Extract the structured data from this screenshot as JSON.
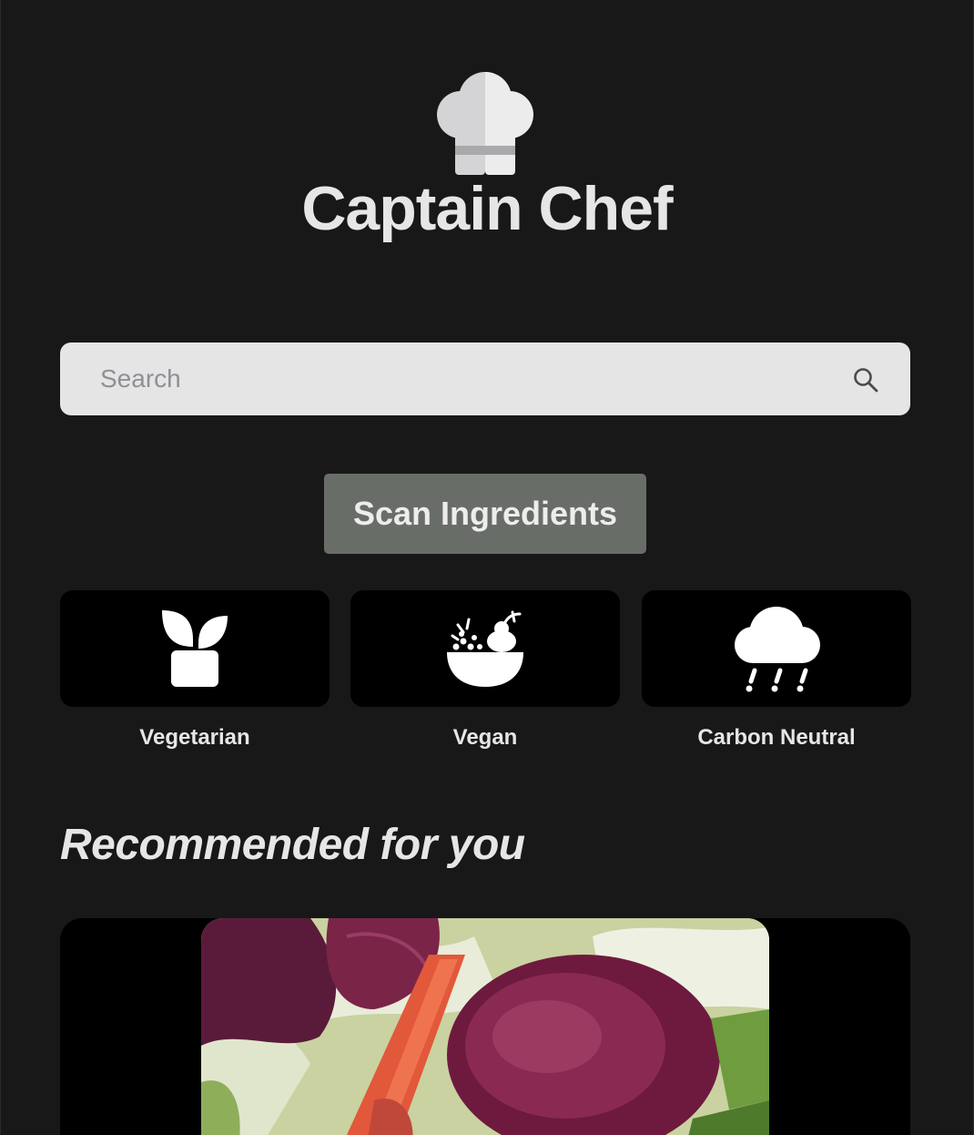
{
  "app": {
    "title": "Captain Chef",
    "logo_icon": "chef-hat-icon"
  },
  "search": {
    "placeholder": "Search",
    "value": "",
    "icon": "search-icon"
  },
  "scan_button": {
    "label": "Scan Ingredients"
  },
  "categories": [
    {
      "label": "Vegetarian",
      "icon": "plant-pot-icon"
    },
    {
      "label": "Vegan",
      "icon": "salad-bowl-icon"
    },
    {
      "label": "Carbon Neutral",
      "icon": "cloud-rain-icon"
    }
  ],
  "recommended": {
    "title": "Recommended for you",
    "items": [
      {
        "image": "beet-salad-photo"
      }
    ]
  },
  "colors": {
    "background": "#181819",
    "text": "#e6e6e6",
    "search_bg": "#e5e5e6",
    "scan_button_bg": "#686e67",
    "tile_bg": "#000000"
  }
}
